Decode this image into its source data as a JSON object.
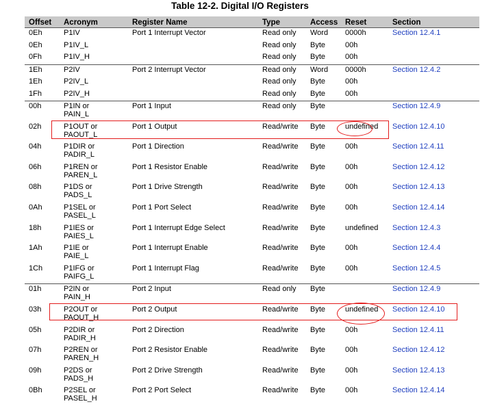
{
  "title": "Table 12-2. Digital I/O Registers",
  "headers": [
    "Offset",
    "Acronym",
    "Register Name",
    "Type",
    "Access",
    "Reset",
    "Section"
  ],
  "rows": [
    {
      "offset": "0Eh",
      "acronym": [
        "P1IV"
      ],
      "name": "Port 1 Interrupt Vector",
      "type": "Read only",
      "access": "Word",
      "reset": "0000h",
      "section": "Section 12.4.1",
      "group_start": true
    },
    {
      "offset": "0Eh",
      "acronym": [
        "P1IV_L"
      ],
      "name": "",
      "type": "Read only",
      "access": "Byte",
      "reset": "00h",
      "section": ""
    },
    {
      "offset": "0Fh",
      "acronym": [
        "P1IV_H"
      ],
      "name": "",
      "type": "Read only",
      "access": "Byte",
      "reset": "00h",
      "section": ""
    },
    {
      "offset": "1Eh",
      "acronym": [
        "P2IV"
      ],
      "name": "Port 2 Interrupt Vector",
      "type": "Read only",
      "access": "Word",
      "reset": "0000h",
      "section": "Section 12.4.2",
      "group_start": true
    },
    {
      "offset": "1Eh",
      "acronym": [
        "P2IV_L"
      ],
      "name": "",
      "type": "Read only",
      "access": "Byte",
      "reset": "00h",
      "section": ""
    },
    {
      "offset": "1Fh",
      "acronym": [
        "P2IV_H"
      ],
      "name": "",
      "type": "Read only",
      "access": "Byte",
      "reset": "00h",
      "section": ""
    },
    {
      "offset": "00h",
      "acronym": [
        "P1IN or",
        "PAIN_L"
      ],
      "name": "Port 1 Input",
      "type": "Read only",
      "access": "Byte",
      "reset": "",
      "section": "Section 12.4.9",
      "group_start": true
    },
    {
      "offset": "02h",
      "acronym": [
        "P1OUT or",
        "PAOUT_L"
      ],
      "name": "Port 1 Output",
      "type": "Read/write",
      "access": "Byte",
      "reset": "undefined",
      "section": "Section 12.4.10"
    },
    {
      "offset": "04h",
      "acronym": [
        "P1DIR or",
        "PADIR_L"
      ],
      "name": "Port 1 Direction",
      "type": "Read/write",
      "access": "Byte",
      "reset": "00h",
      "section": "Section 12.4.11"
    },
    {
      "offset": "06h",
      "acronym": [
        "P1REN or",
        "PAREN_L"
      ],
      "name": "Port 1 Resistor Enable",
      "type": "Read/write",
      "access": "Byte",
      "reset": "00h",
      "section": "Section 12.4.12"
    },
    {
      "offset": "08h",
      "acronym": [
        "P1DS or",
        "PADS_L"
      ],
      "name": "Port 1 Drive Strength",
      "type": "Read/write",
      "access": "Byte",
      "reset": "00h",
      "section": "Section 12.4.13"
    },
    {
      "offset": "0Ah",
      "acronym": [
        "P1SEL or",
        "PASEL_L"
      ],
      "name": "Port 1 Port Select",
      "type": "Read/write",
      "access": "Byte",
      "reset": "00h",
      "section": "Section 12.4.14"
    },
    {
      "offset": "18h",
      "acronym": [
        "P1IES or",
        "PAIES_L"
      ],
      "name": "Port 1 Interrupt Edge Select",
      "type": "Read/write",
      "access": "Byte",
      "reset": "undefined",
      "section": "Section 12.4.3"
    },
    {
      "offset": "1Ah",
      "acronym": [
        "P1IE or",
        "PAIE_L"
      ],
      "name": "Port 1 Interrupt Enable",
      "type": "Read/write",
      "access": "Byte",
      "reset": "00h",
      "section": "Section 12.4.4"
    },
    {
      "offset": "1Ch",
      "acronym": [
        "P1IFG or",
        "PAIFG_L"
      ],
      "name": "Port 1 Interrupt Flag",
      "type": "Read/write",
      "access": "Byte",
      "reset": "00h",
      "section": "Section 12.4.5"
    },
    {
      "offset": "01h",
      "acronym": [
        "P2IN or",
        "PAIN_H"
      ],
      "name": "Port 2 Input",
      "type": "Read only",
      "access": "Byte",
      "reset": "",
      "section": "Section 12.4.9",
      "group_start": true
    },
    {
      "offset": "03h",
      "acronym": [
        "P2OUT or",
        "PAOUT_H"
      ],
      "name": "Port 2 Output",
      "type": "Read/write",
      "access": "Byte",
      "reset": "undefined",
      "section": "Section 12.4.10"
    },
    {
      "offset": "05h",
      "acronym": [
        "P2DIR or",
        "PADIR_H"
      ],
      "name": "Port 2 Direction",
      "type": "Read/write",
      "access": "Byte",
      "reset": "00h",
      "section": "Section 12.4.11"
    },
    {
      "offset": "07h",
      "acronym": [
        "P2REN or",
        "PAREN_H"
      ],
      "name": "Port 2 Resistor Enable",
      "type": "Read/write",
      "access": "Byte",
      "reset": "00h",
      "section": "Section 12.4.12"
    },
    {
      "offset": "09h",
      "acronym": [
        "P2DS or",
        "PADS_H"
      ],
      "name": "Port 2 Drive Strength",
      "type": "Read/write",
      "access": "Byte",
      "reset": "00h",
      "section": "Section 12.4.13"
    },
    {
      "offset": "0Bh",
      "acronym": [
        "P2SEL or",
        "PASEL_H"
      ],
      "name": "Port 2 Port Select",
      "type": "Read/write",
      "access": "Byte",
      "reset": "00h",
      "section": "Section 12.4.14"
    }
  ],
  "highlight_color": "#e31b1b",
  "link_color": "#1f3fbf"
}
